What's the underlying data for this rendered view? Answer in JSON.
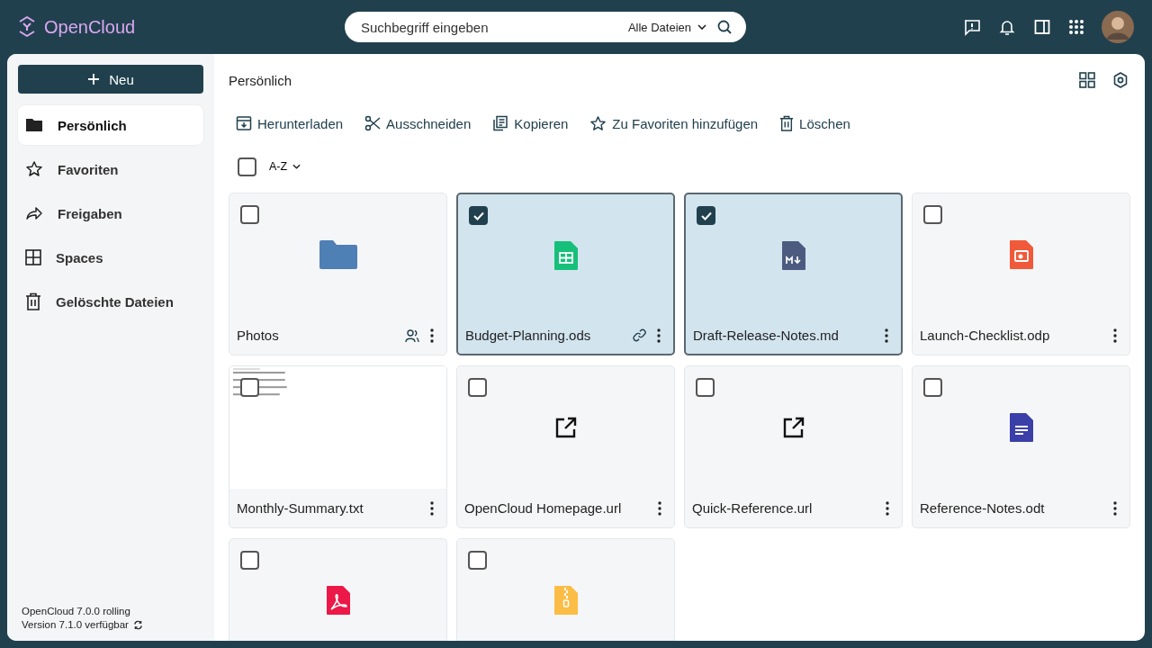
{
  "header": {
    "logo": "OpenCloud",
    "search": {
      "placeholder": "Suchbegriff eingeben"
    },
    "scope": "Alle Dateien"
  },
  "sidebar": {
    "new_button": "Neu",
    "items": [
      {
        "label": "Persönlich",
        "kind": "folder",
        "selected": true
      },
      {
        "label": "Favoriten",
        "kind": "star",
        "selected": false
      },
      {
        "label": "Freigaben",
        "kind": "share",
        "selected": false
      },
      {
        "label": "Spaces",
        "kind": "grid",
        "selected": false
      },
      {
        "label": "Gelöschte Dateien",
        "kind": "trash",
        "selected": false
      }
    ],
    "version": "OpenCloud 7.0.0 rolling",
    "update": "Version 7.1.0 verfügbar"
  },
  "breadcrumb": "Persönlich",
  "actions": [
    {
      "label": "Herunterladen",
      "kind": "download"
    },
    {
      "label": "Ausschneiden",
      "kind": "cut"
    },
    {
      "label": "Kopieren",
      "kind": "copy"
    },
    {
      "label": "Zu Favoriten hinzufügen",
      "kind": "star"
    },
    {
      "label": "Löschen",
      "kind": "trash"
    }
  ],
  "select_all": {
    "checked": false
  },
  "sort": "A-Z",
  "files": [
    {
      "name": "Photos",
      "kind": "folder",
      "selected": false,
      "shared": true,
      "linked": false
    },
    {
      "name": "Budget-Planning.ods",
      "kind": "spreadsheet",
      "selected": true,
      "shared": false,
      "linked": true
    },
    {
      "name": "Draft-Release-Notes.md",
      "kind": "markdown",
      "selected": true,
      "shared": false,
      "linked": false
    },
    {
      "name": "Launch-Checklist.odp",
      "kind": "presentation",
      "selected": false,
      "shared": false,
      "linked": false
    },
    {
      "name": "Monthly-Summary.txt",
      "kind": "preview",
      "selected": false,
      "shared": false,
      "linked": false
    },
    {
      "name": "OpenCloud Homepage.url",
      "kind": "url",
      "selected": false,
      "shared": false,
      "linked": false
    },
    {
      "name": "Quick-Reference.url",
      "kind": "url",
      "selected": false,
      "shared": false,
      "linked": false
    },
    {
      "name": "Reference-Notes.odt",
      "kind": "document",
      "selected": false,
      "shared": false,
      "linked": false
    },
    {
      "kind": "pdf",
      "selected": false,
      "shared": false,
      "linked": false
    },
    {
      "kind": "archive",
      "selected": false,
      "shared": false,
      "linked": false
    }
  ]
}
